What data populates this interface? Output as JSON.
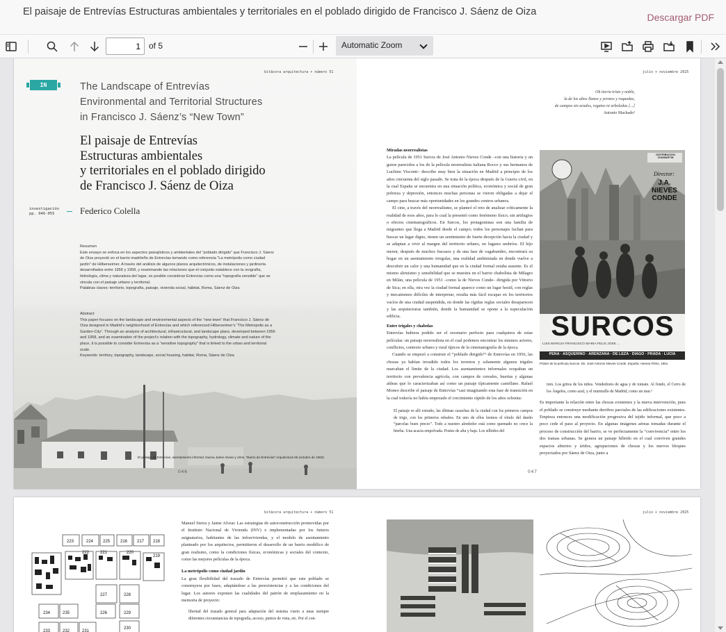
{
  "window": {
    "document_title": "El paisaje de Entrevías Estructuras ambientales y territoriales en el poblado dirigido de Francisco J. Sáenz de Oiza",
    "download_label": "Descargar PDF"
  },
  "toolbar": {
    "page_value": "1",
    "page_total": "of 5",
    "zoom_label": "Automatic Zoom",
    "icons": [
      "sidebar-toggle-icon",
      "search-icon",
      "arrow-up-icon",
      "arrow-down-icon",
      "minus-icon",
      "plus-icon",
      "presentation-icon",
      "open-file-icon",
      "print-icon",
      "download-icon",
      "bookmark-icon",
      "double-chevron-right-icon"
    ]
  },
  "page1": {
    "left": {
      "running_header": "bitácora arquitectura + número 51",
      "badge": "IN",
      "english_title": [
        "The Landscape of Entrevías",
        "Environmental and Territorial Structures",
        "in Francisco J. Sáenz’s “New Town”"
      ],
      "spanish_title": [
        "El paisaje de Entrevías",
        "Estructuras ambientales",
        "y territoriales en el poblado dirigido",
        "de Francisco J. Sáenz de Oiza"
      ],
      "section": "investigación",
      "pages": "pp. 046-055",
      "author": "Federico Colella",
      "resumen_heading": "Resumen",
      "resumen_text": "Este ensayo se enfoca en los aspectos paisajísticos y ambientales del “poblado dirigido” que Francisco J. Sáenz de Oiza proyectó en el barrio madrileño de Entrevías tomando como referencia “La metrópolis como ciudad jardín” de Hilberseimer. A través del análisis de algunos planos arquitectónicos, de instalaciones y jardinería desarrollados entre 1956 y 1958, y examinando las relaciones que el conjunto establece con la orografía, hidrología, clima y naturaleza del lugar, es posible considerar Entrevías como una “topografía sensible” que se vincula con el paisaje urbano y territorial.",
      "resumen_keywords": "Palabras claves: territorio, topografía, paisaje, vivienda social, hábitat, Roma, Sáenz de Oiza",
      "abstract_heading": "Abstract",
      "abstract_text": "This paper focuses on the landscape and environmental aspects of the “new town” that Francisco J. Sáenz de Oiza designed in Madrid’s neighborhood of Entrevías and which referenced Hilberseimer’s “The Metropolis as a Garden-City”. Through an analysis of architectural, infrastructural, and landscape plans, developed between 1956 and 1958, and an examination of the project’s relation with the topography, hydrology, climate and nature of the place, it is possible to consider Entrevías as a “sensitive topography” that is linked to the urban and territorial scale.",
      "abstract_keywords": "Keywords: territory, topography, landscape, social housing, habitat, Roma, Sáenz de Oiza",
      "photo_caption": "El paisaje de Entrevías, asentamiento informal. Nueva Jaime Alvear y otros, “Barrio de Entrevías” Arquitectura 56 (octubre de 1963)",
      "page_number": "046"
    },
    "right": {
      "running_header": "julio + noviembre 2025",
      "quote": [
        "Oh tierra triste y noble,",
        "la de los altos llanos y yermos y roquedas,",
        "de campos sin arados, regatos ni arboledas [...]",
        "Antonio Machado¹"
      ],
      "col1_h1": "Miradas neorrealistas",
      "col1_p1": "La película de 1951 Surcos de José Antonio Nieves Conde –con una historia y un guion parecidos a los de la película neorrealista italiana Rocco y sus hermanos de Luchino Visconti– describe muy bien la situación en Madrid a principio de los años cincuenta del siglo pasado. Se trata de la época después de la Guerra civil, en la cual España se encuentra en una situación política, económica y social de gran pobreza y depresión, entonces muchas personas se vieron obligadas a dejar el campo para buscar más oportunidades en los grandes centros urbanos.",
      "col1_p2": "El cine, a través del neorrealismo, se planteó el reto de analizar críticamente la realidad de esos años, para lo cual la presentó como fenómeno físico, sin artilugios o efectos cinematográficos. En Surcos, los protagonistas son una familia de migrantes que llega a Madrid desde el campo; todos los personajes luchan para buscar un lugar digno, tienen un sentimiento de fuerte decepción hacia la ciudad y se adaptan a vivir al margen del territorio urbano, en lugares umbríos. El hijo menor, después de muchos fracasos y de una fase de vagabundeo, encontrará su hogar en un asentamiento irregular, una realidad ambientada en donde vuelve a descubrir un calor y una humanidad que en la ciudad formal estaba ausente. Es el mismo altruismo y sensibilidad que se muestra en el barrio chabolista de Milagro en Milán, una película de 1951 –como la de Nieves Conde– dirigida por Vittorio de Sica; en ella, otra vez la ciudad formal aparece como un lugar hostil, con reglas y mecanismos difíciles de interpretar, resulta más fácil escapar en los territorios vacíos de una ciudad suspendida, en donde las rígidas reglas sociales desaparecen y las arquitecturas también, donde la humanidad se opone a la especulación edilicia.",
      "col1_h2": "Entre trigales y chabolas",
      "col1_p3": "Entrevías hubiera podido ser el escenario perfecto para cualquiera de estas películas: un paisaje neorrealista en el cual podemos encontrar los mismos actores, conflictos, contexto urbano y rural típicos de la cinematografía de la época.",
      "col1_p4": "Cuando se empezó a construir el “poblado dirigido”² de Entrevías en 1956, las chozas ya habían invadido todos los terrenos y solamente algunos trigales marcaban el límite de la ciudad. Los asentamientos informales ocupaban un territorio con prevalencia agrícola, con campos de cereales, huertas y algunas aldeas que lo caracterizaban así como un paisaje típicamente castellano. Rafael Moneo describe el paisaje de Entrevías “casi imaginando esta fase de transición en la cual todavía no había empezado el crecimiento rápido de los años ochenta:",
      "col1_quote": "El paisaje es alli extraño, las últimas casuchas de la ciudad con los primeros campos de trigo, con los primeros rebaños. En uno de ellos leemos el rótulo del dueño “parcelas buen precio”. Todo a nuestro alrededor está como quemado no crece la hierba. Una acacia empolvada. Postes de alta y baja. Los silbidos del",
      "poster": {
        "distribution": "DISTRIBUCION CHAMARTIN",
        "director_label": "Director:",
        "director": "J.A. NIEVES CONDE",
        "title": "SURCOS",
        "cast_line": "LUIS   MARUJA   FRANCISCO   MARIA   FELIX   JOSE   ...",
        "names_line": "PENA · ASQUERINO · ARENZANA · DE LEZA · DIAGO · PRADA · LUCIA"
      },
      "poster_caption": "Póster de la película Surcos. Dir. José Antonio Nieves Conde. España: Atenea Films, 1951",
      "col2_p1": "tren. Los gritos de los niños. Vendedores de agua y de tomate. Al fondo, el Cerro de los Ángeles, como azul, y el murmullo de Madrid, como un mar.³",
      "col2_p2": "Es importante la relación entre las chozas existentes y la nueva intervención, pues el poblado se construye mediante derribos parciales de las edificaciones existentes. Empieza entonces una modificación progresiva del tejido informal, que poco a poco cede el paso al proyecto. En algunas imágenes aéreas tomadas durante el proceso de construcción del barrio, se ve perfectamente la “convivencia” entre los dos tramas urbanas. Se genera un paisaje híbrido en el cual conviven grandes espacios abiertos y áridos, agrupaciones de chozas y los nuevos bloques proyectados por Sáenz de Oiza, junto a",
      "page_number": "047"
    }
  },
  "page2": {
    "left_header": "bitácora arquitectura + número 51",
    "right_header": "julio + noviembre 2025",
    "map_labels": [
      "223",
      "224",
      "225",
      "216",
      "217",
      "218",
      "222",
      "221",
      "220",
      "219",
      "227",
      "228",
      "234",
      "235",
      "226",
      "229",
      "233",
      "232",
      "231",
      "230"
    ],
    "col_p1": "Manuel Sierra y Jaime Alvear. Las estrategias de autoconstrucción promovidas por el Instituto Nacional de Vivienda (INV) e implementadas por los futuros asignatarios, habitantes de las infraviviendas, y el modelo de asentamiento planteado por los arquitectos, permitieron el desarrollo de un barrio modélico de gran realismo, como la condiciones físicas, económicas y sociales del contexto, como las mejores películas de la época.",
    "col_h": "La metrópolis como ciudad jardín",
    "col_p2": "La gran flexibilidad del trazado de Entrevías permitió que este poblado se construyera por fases, adaptándose a las preexistencias y a las condiciones del lugar. Los autores exponen las cualidades del patrón de emplazamiento en la memoria de proyecto:",
    "col_quote": "libertad del trazado general para adaptación del sistema viario a unas siempre diferentes circunstancias de topografía, acceso, puntos de vista, etc. Por el con-"
  }
}
